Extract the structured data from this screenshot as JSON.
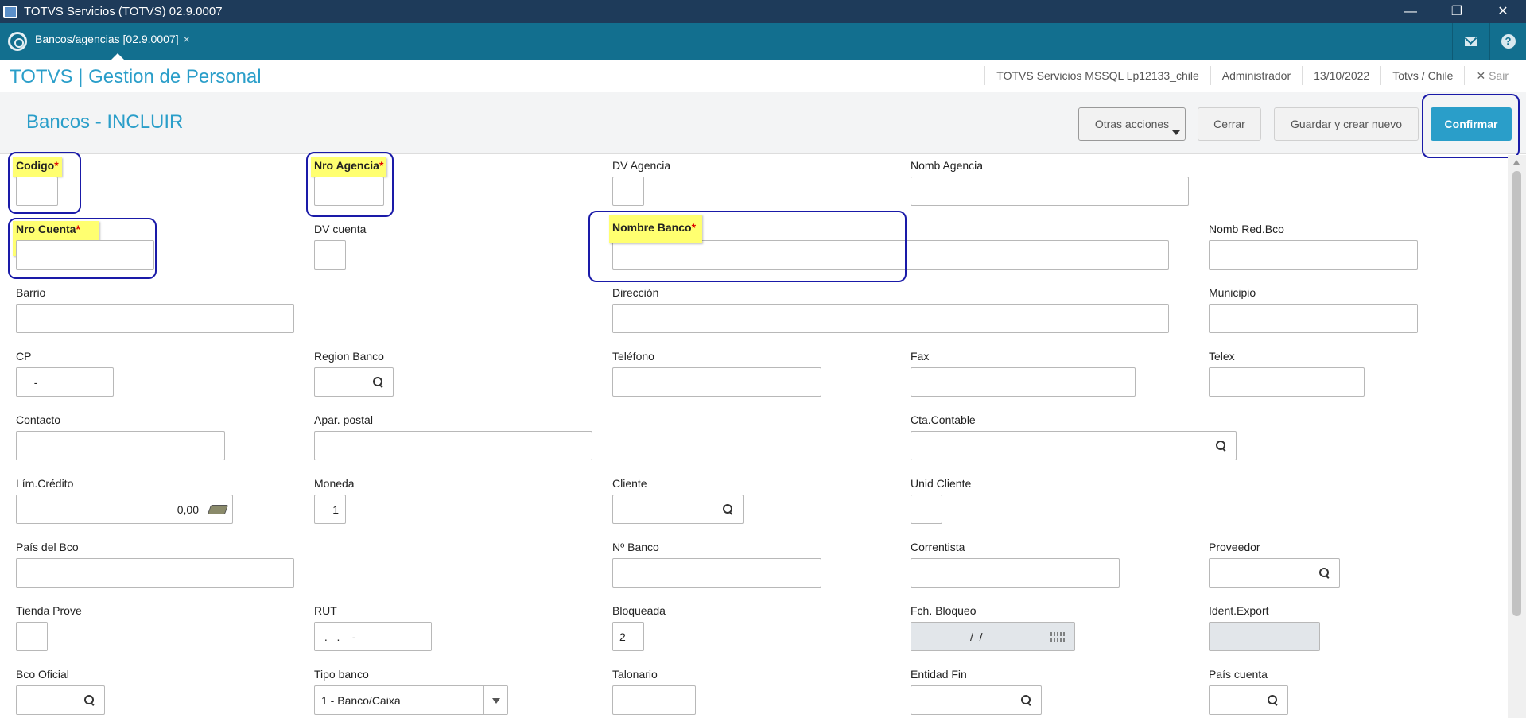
{
  "window": {
    "title": "TOTVS Servicios (TOTVS) 02.9.0007",
    "controls": [
      "—",
      "❐",
      "✕"
    ]
  },
  "tabs": [
    {
      "label": "Bancos/agencias [02.9.0007]",
      "close": "×"
    }
  ],
  "header": {
    "brand": "TOTVS | Gestion de Personal",
    "environment": "TOTVS Servicios MSSQL Lp12133_chile",
    "user": "Administrador",
    "date": "13/10/2022",
    "company": "Totvs / Chile",
    "exit_label": "Sair"
  },
  "page": {
    "title": "Bancos - INCLUIR",
    "buttons": {
      "otras": "Otras acciones",
      "cerrar": "Cerrar",
      "guardar": "Guardar y crear nuevo",
      "confirmar": "Confirmar"
    }
  },
  "accent_color": "#2a9ec9",
  "highlight_color": "#ffff70",
  "form": {
    "codigo": {
      "label": "Codigo",
      "required": "*",
      "value": ""
    },
    "nro_agencia": {
      "label": "Nro Agencia",
      "required": "*",
      "value": ""
    },
    "dv_agencia": {
      "label": "DV Agencia",
      "value": ""
    },
    "nomb_agencia": {
      "label": "Nomb Agencia",
      "value": ""
    },
    "nro_cuenta": {
      "label": "Nro Cuenta",
      "required": "*",
      "value": ""
    },
    "dv_cuenta": {
      "label": "DV cuenta",
      "value": ""
    },
    "nombre_banco": {
      "label": "Nombre Banco",
      "required": "*",
      "value": ""
    },
    "nomb_red_bco": {
      "label": "Nomb Red.Bco",
      "value": ""
    },
    "barrio": {
      "label": "Barrio",
      "value": ""
    },
    "direccion": {
      "label": "Dirección",
      "value": ""
    },
    "municipio": {
      "label": "Municipio",
      "value": ""
    },
    "cp": {
      "label": "CP",
      "value": "  -"
    },
    "region_banco": {
      "label": "Region Banco",
      "value": ""
    },
    "telefono": {
      "label": "Teléfono",
      "value": ""
    },
    "fax": {
      "label": "Fax",
      "value": ""
    },
    "telex": {
      "label": "Telex",
      "value": ""
    },
    "contacto": {
      "label": "Contacto",
      "value": ""
    },
    "apar_postal": {
      "label": "Apar. postal",
      "value": ""
    },
    "cta_contable": {
      "label": "Cta.Contable",
      "value": ""
    },
    "lim_credito": {
      "label": "Lím.Crédito",
      "value": "0,00"
    },
    "moneda": {
      "label": "Moneda",
      "value": "1"
    },
    "cliente": {
      "label": "Cliente",
      "value": ""
    },
    "unid_cliente": {
      "label": "Unid Cliente",
      "value": ""
    },
    "pais_bco": {
      "label": "País del Bco",
      "value": ""
    },
    "nro_banco": {
      "label": "Nº Banco",
      "value": ""
    },
    "correntista": {
      "label": "Correntista",
      "value": ""
    },
    "proveedor": {
      "label": "Proveedor",
      "value": ""
    },
    "tienda_prove": {
      "label": "Tienda Prove",
      "value": ""
    },
    "rut": {
      "label": "RUT",
      "value": " .   .    -"
    },
    "bloqueada": {
      "label": "Bloqueada",
      "value": "2"
    },
    "fch_bloqueo": {
      "label": "Fch. Bloqueo",
      "value": "/  /"
    },
    "ident_export": {
      "label": "Ident.Export",
      "value": ""
    },
    "bco_oficial": {
      "label": "Bco Oficial",
      "value": ""
    },
    "tipo_banco": {
      "label": "Tipo banco",
      "value": "1 - Banco/Caixa"
    },
    "talonario": {
      "label": "Talonario",
      "value": ""
    },
    "entidad_fin": {
      "label": "Entidad Fin",
      "value": ""
    },
    "pais_cuenta": {
      "label": "País cuenta",
      "value": ""
    }
  }
}
